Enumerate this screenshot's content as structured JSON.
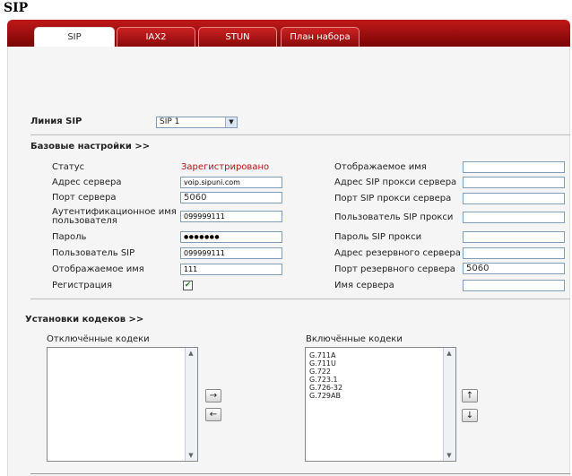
{
  "page_title": "SIP",
  "tabs": [
    "SIP",
    "IAX2",
    "STUN",
    "План набора"
  ],
  "sip_line": {
    "label": "Линия SIP",
    "value": "SIP 1"
  },
  "basic_header": "Базовые настройки >>",
  "left_fields": {
    "status": {
      "label": "Статус",
      "value": "Зарегистрировано"
    },
    "server_address": {
      "label": "Адрес сервера",
      "value": "voip.sipuni.com"
    },
    "server_port": {
      "label": "Порт сервера",
      "value": "5060"
    },
    "auth_name": {
      "label_line1": "Аутентификационное имя",
      "label_line2": "пользователя",
      "value": "099999111"
    },
    "password": {
      "label": "Пароль",
      "value": "●●●●●●●"
    },
    "sip_user": {
      "label": "Пользователь SIP",
      "value": "099999111"
    },
    "display_name": {
      "label": "Отображаемое имя",
      "value": "111"
    },
    "registration": {
      "label": "Регистрация",
      "checked": true
    }
  },
  "right_fields": {
    "display_name": {
      "label": "Отображаемое имя",
      "value": ""
    },
    "proxy_address": {
      "label": "Адрес SIP прокси сервера",
      "value": ""
    },
    "proxy_port": {
      "label": "Порт SIP прокси сервера",
      "value": ""
    },
    "proxy_user": {
      "label": "Пользователь SIP прокси",
      "value": ""
    },
    "proxy_password": {
      "label": "Пароль SIP прокси",
      "value": ""
    },
    "backup_address": {
      "label": "Адрес резервного сервера",
      "value": ""
    },
    "backup_port": {
      "label": "Порт резервного сервера",
      "value": "5060"
    },
    "server_name": {
      "label": "Имя сервера",
      "value": ""
    }
  },
  "codecs": {
    "header": "Установки кодеков >>",
    "disabled_label": "Отключённые кодеки",
    "enabled_label": "Включённые кодеки",
    "enabled": [
      "G.711A",
      "G.711U",
      "G.722",
      "G.723.1",
      "G.726-32",
      "G.729AB"
    ],
    "arrows": {
      "right": "→",
      "left": "←",
      "up": "↑",
      "down": "↓"
    }
  }
}
